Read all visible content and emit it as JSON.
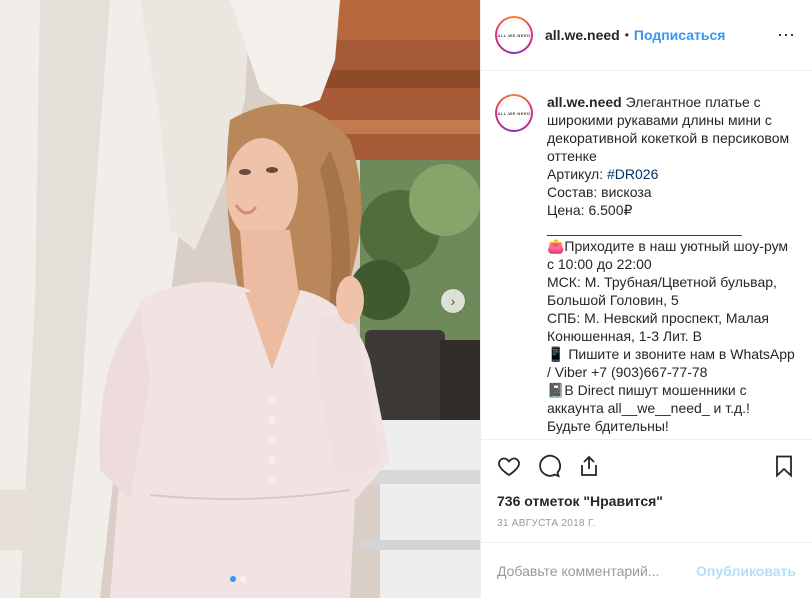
{
  "header": {
    "avatar_text": "ALL.WE.NEED",
    "username": "all.we.need",
    "separator": "•",
    "follow_label": "Подписаться",
    "more_icon": "more-horizontal-icon"
  },
  "caption": {
    "avatar_text": "ALL.WE.NEED",
    "username": "all.we.need",
    "line1": " Элегантное платье с широкими рукавами длины мини с декоративной кокеткой в персиковом оттенке\nАртикул: ",
    "hashtag": "#DR026",
    "line2": "\nСостав: вискоза\nЦена: 6.500₽\n_________________________\n👛Приходите в наш уютный шоу-рум с 10:00 до 22:00\nМСК: М. Трубная/Цветной бульвар, Большой Головин, 5\nСПБ: М. Невский проспект, Малая Конюшенная, 1-3 Лит. В\n📱 Пишите и звоните нам в WhatsApp / Viber +7 (903)667-77-78\n📓В Direct пишут мошенники с аккаунта all__we__need_ и т.д.! Будьте бдительны!"
  },
  "actions": {
    "like_icon": "heart-icon",
    "comment_icon": "comment-icon",
    "share_icon": "share-icon",
    "save_icon": "bookmark-icon"
  },
  "likes_text": "736 отметок \"Нравится\"",
  "date_text": "31 августа 2018 г.",
  "comment": {
    "placeholder": "Добавьте комментарий...",
    "value": "",
    "publish_label": "Опубликовать"
  },
  "media": {
    "next_icon": "chevron-right-icon",
    "next_glyph": "›",
    "carousel_total": 2,
    "carousel_active": 1
  },
  "colors": {
    "link": "#3897f0",
    "publish_disabled": "#b2dffc",
    "hashtag": "#003569"
  }
}
